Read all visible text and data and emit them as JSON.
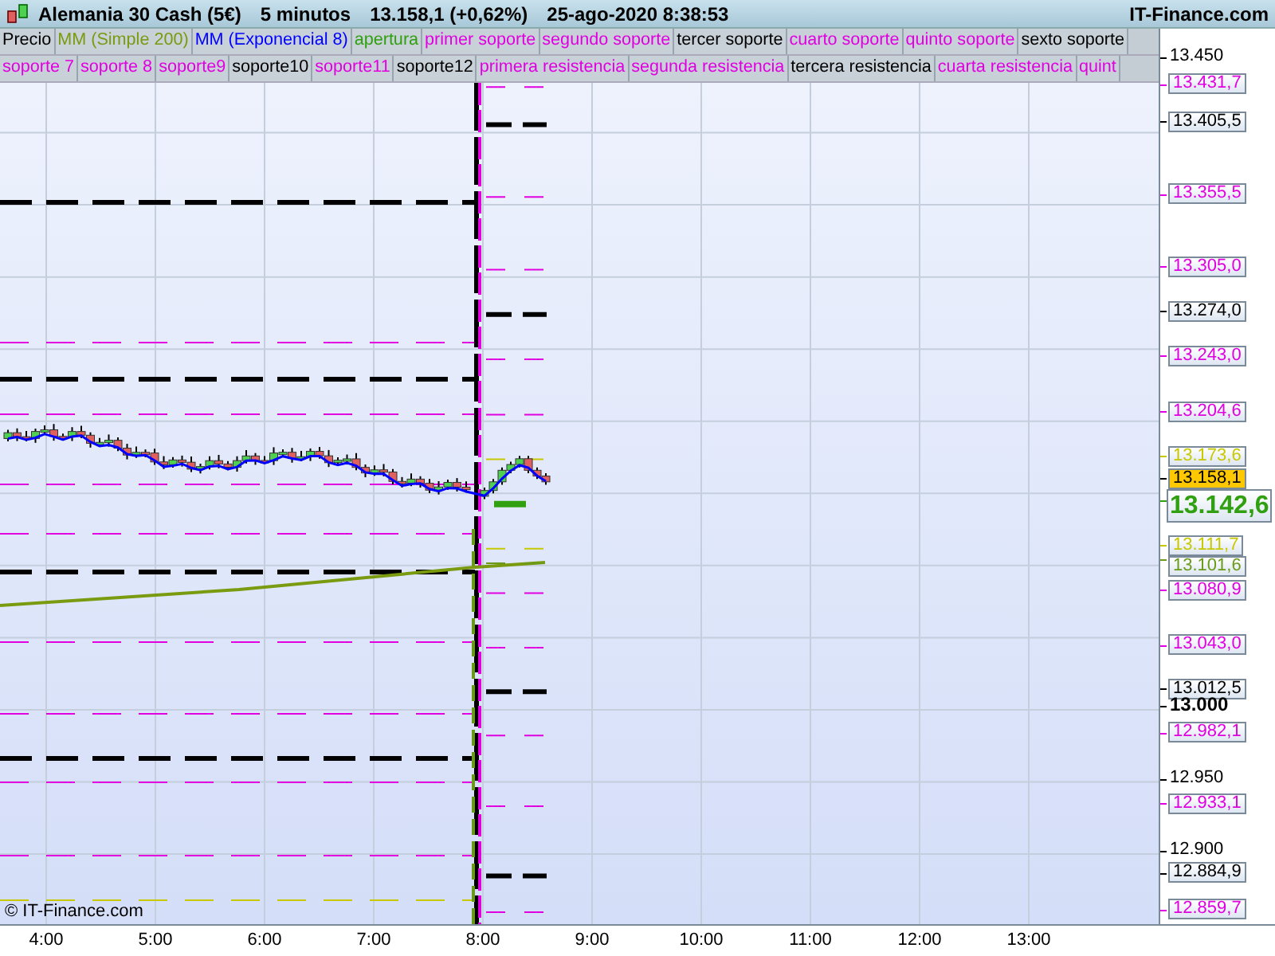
{
  "header": {
    "title": "Alemania 30 Cash (5€)",
    "interval": "5 minutos",
    "quote": "13.158,1 (+0,62%)",
    "datetime": "25-ago-2020 8:38:53",
    "brand": "IT-Finance.com"
  },
  "legend": [
    [
      {
        "label": "Precio",
        "color": "#000000"
      },
      {
        "label": "MM (Simple 200)",
        "color": "#7a9a10"
      },
      {
        "label": "MM (Exponencial 8)",
        "color": "#0000ff"
      },
      {
        "label": "apertura",
        "color": "#30a010"
      },
      {
        "label": "primer soporte",
        "color": "#e000e0"
      },
      {
        "label": "segundo soporte",
        "color": "#e000e0"
      },
      {
        "label": "tercer soporte",
        "color": "#000000"
      },
      {
        "label": "cuarto soporte",
        "color": "#e000e0"
      },
      {
        "label": "quinto soporte",
        "color": "#e000e0"
      },
      {
        "label": "sexto soporte",
        "color": "#000000"
      }
    ],
    [
      {
        "label": "soporte 7",
        "color": "#e000e0"
      },
      {
        "label": "soporte 8",
        "color": "#e000e0"
      },
      {
        "label": "soporte9",
        "color": "#e000e0"
      },
      {
        "label": "soporte10",
        "color": "#000000"
      },
      {
        "label": "soporte11",
        "color": "#e000e0"
      },
      {
        "label": "soporte12",
        "color": "#000000"
      },
      {
        "label": "primera resistencia",
        "color": "#e000e0"
      },
      {
        "label": "segunda resistencia",
        "color": "#e000e0"
      },
      {
        "label": "tercera resistencia",
        "color": "#000000"
      },
      {
        "label": "cuarta resistencia",
        "color": "#e000e0"
      },
      {
        "label": "quint",
        "color": "#e000e0"
      }
    ]
  ],
  "price_axis": [
    {
      "label": "13.450",
      "kind": "tick"
    },
    {
      "label": "13.431,7",
      "kind": "level",
      "color": "#e000e0"
    },
    {
      "label": "13.405,5",
      "kind": "level",
      "color": "#000000"
    },
    {
      "label": "13.355,5",
      "kind": "level",
      "color": "#e000e0"
    },
    {
      "label": "13.305,0",
      "kind": "level",
      "color": "#e000e0"
    },
    {
      "label": "13.274,0",
      "kind": "level",
      "color": "#000000"
    },
    {
      "label": "13.243,0",
      "kind": "level",
      "color": "#e000e0"
    },
    {
      "label": "13.204,6",
      "kind": "level",
      "color": "#e000e0"
    },
    {
      "label": "13.173,6",
      "kind": "level",
      "color": "#c8c800"
    },
    {
      "label": "13.158,1",
      "kind": "last"
    },
    {
      "label": "13.142,6",
      "kind": "quote",
      "color": "#30a010"
    },
    {
      "label": "13.111,7",
      "kind": "level",
      "color": "#c8c800"
    },
    {
      "label": "13.101,6",
      "kind": "level",
      "color": "#6b9a1a"
    },
    {
      "label": "13.080,9",
      "kind": "level",
      "color": "#e000e0"
    },
    {
      "label": "13.043,0",
      "kind": "level",
      "color": "#e000e0"
    },
    {
      "label": "13.012,5",
      "kind": "level",
      "color": "#000000"
    },
    {
      "label": "13.000",
      "kind": "major"
    },
    {
      "label": "12.982,1",
      "kind": "level",
      "color": "#e000e0"
    },
    {
      "label": "12.950",
      "kind": "tick"
    },
    {
      "label": "12.933,1",
      "kind": "level",
      "color": "#e000e0"
    },
    {
      "label": "12.900",
      "kind": "tick"
    },
    {
      "label": "12.884,9",
      "kind": "level",
      "color": "#000000"
    },
    {
      "label": "12.859,7",
      "kind": "level",
      "color": "#e000e0"
    }
  ],
  "time_axis": [
    "4:00",
    "5:00",
    "6:00",
    "7:00",
    "8:00",
    "9:00",
    "10:00",
    "11:00",
    "12:00",
    "13:00"
  ],
  "credit": "© IT-Finance.com"
}
